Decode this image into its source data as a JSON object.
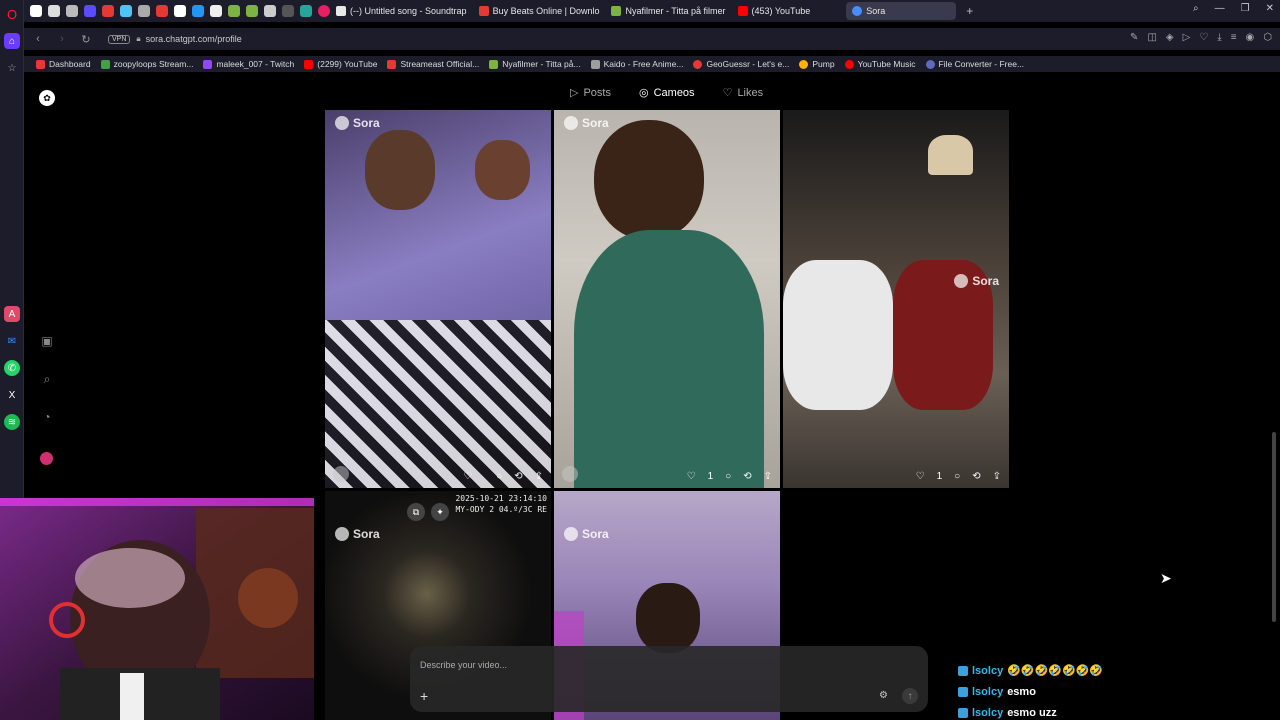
{
  "browser": {
    "tabs": [
      {
        "title": "(--) Untitled song - Soundtrap",
        "color": "#e8e8e8"
      },
      {
        "title": "Buy Beats Online | Downlo",
        "color": "#e53935"
      },
      {
        "title": "Nyafilmer - Titta på filmer",
        "color": "#7cb342"
      },
      {
        "title": "(453) YouTube",
        "color": "#ff0000"
      },
      {
        "title": "Sora",
        "color": "#4a8cff"
      }
    ],
    "active_tab_index": 4,
    "new_tab_label": "+",
    "url": "sora.chatgpt.com/profile",
    "vpn_label": "VPN",
    "bookmarks": [
      {
        "label": "Dashboard",
        "color": "#e53935"
      },
      {
        "label": "zoopyloops Stream...",
        "color": "#43a047"
      },
      {
        "label": "maleek_007 - Twitch",
        "color": "#9146ff"
      },
      {
        "label": "(2299) YouTube",
        "color": "#ff0000"
      },
      {
        "label": "Streameast Official...",
        "color": "#e53935"
      },
      {
        "label": "Nyafilmer - Titta på...",
        "color": "#7cb342"
      },
      {
        "label": "Kaido - Free Anime...",
        "color": "#9e9e9e"
      },
      {
        "label": "GeoGuessr - Let's e...",
        "color": "#e53935"
      },
      {
        "label": "Pump",
        "color": "#ffb300"
      },
      {
        "label": "YouTube Music",
        "color": "#ff0000"
      },
      {
        "label": "File Converter - Free...",
        "color": "#5c6bc0"
      }
    ]
  },
  "sora": {
    "tabs": [
      {
        "label": "Posts",
        "icon": "play-square-icon"
      },
      {
        "label": "Cameos",
        "icon": "cameo-icon"
      },
      {
        "label": "Likes",
        "icon": "heart-icon"
      }
    ],
    "active_tab": "Cameos",
    "badge_label": "Sora",
    "cards": [
      {
        "likes": "",
        "subject": "couple-on-couch-purple-light"
      },
      {
        "likes": "1",
        "subject": "child-eating"
      },
      {
        "likes": "1",
        "subject": "couple-on-sofa"
      },
      {
        "likes": "",
        "subject": "night-bodycam",
        "timestamp": "2025-10-21 23:14:10",
        "overlay_text": "MY-ODY 2 04.º/3C RE"
      },
      {
        "likes": "",
        "subject": "person-purple-room"
      }
    ],
    "composer_placeholder": "Describe your video...",
    "composer_plus": "+"
  },
  "chat": [
    {
      "user": "lsolcy",
      "message": "🤣🤣🤣🤣🤣🤣🤣"
    },
    {
      "user": "lsolcy",
      "message": "esmo"
    },
    {
      "user": "lsolcy",
      "message": "esmo uzz"
    }
  ]
}
